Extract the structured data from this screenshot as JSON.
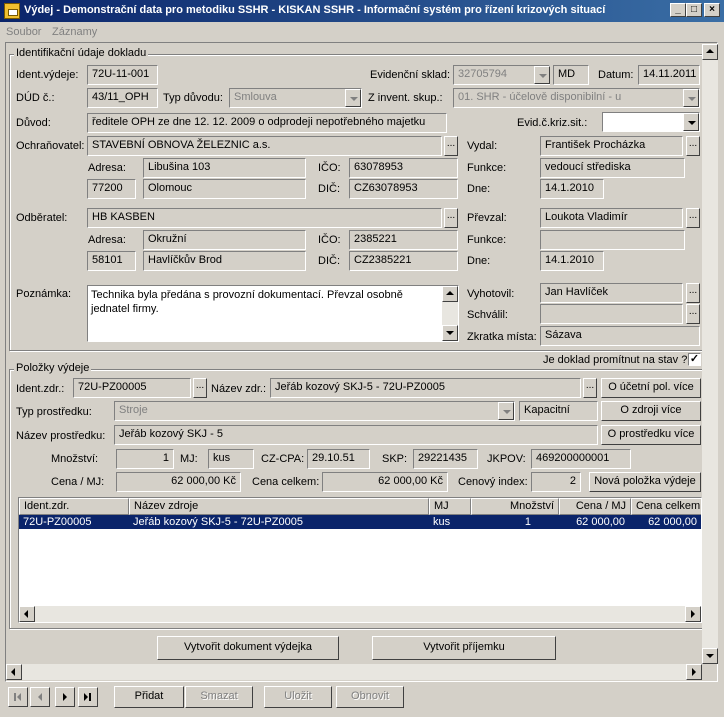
{
  "window": {
    "title": "Výdej - Demonstrační data pro metodiku SSHR - KISKAN SSHR - Informační systém pro řízení krizových situací",
    "minimize": "_",
    "maximize": "□",
    "close": "×"
  },
  "menu": {
    "items": [
      "Soubor",
      "Záznamy"
    ]
  },
  "ident": {
    "group_label": "Identifikační údaje dokladu",
    "ident_vydeje_label": "Ident.výdeje:",
    "ident_vydeje": "72U-11-001",
    "evid_sklad_label": "Evidenční sklad:",
    "evid_sklad": "32705794",
    "mj": "MD",
    "datum_label": "Datum:",
    "datum": "14.11.2011",
    "dud_label": "DÚD č.:",
    "dud": "43/11_OPH",
    "typ_duvodu_label": "Typ důvodu:",
    "typ_duvodu": "Smlouva",
    "z_invent_label": "Z invent. skup.:",
    "z_invent": "01. SHR - účelově disponibilní - u",
    "duvod_label": "Důvod:",
    "duvod": "ředitele OPH ze dne 12. 12. 2009 o odprodeji nepotřebného majetku",
    "evid_kriz_label": "Evid.č.kriz.sit.:",
    "evid_kriz": "",
    "ochranovatel_label": "Ochraňovatel:",
    "ochranovatel": "STAVEBNÍ OBNOVA ŽELEZNIC a.s.",
    "adresa_label": "Adresa:",
    "o_ulice": "Libušina 103",
    "ico_label": "IČO:",
    "o_ico": "63078953",
    "o_psc": "77200",
    "o_mesto": "Olomouc",
    "dic_label": "DIČ:",
    "o_dic": "CZ63078953",
    "vydal_label": "Vydal:",
    "vydal": "František Procházka",
    "funkce_label": "Funkce:",
    "vydal_funkce": "vedoucí střediska",
    "dne_label": "Dne:",
    "vydal_dne": "14.1.2010",
    "odberatel_label": "Odběratel:",
    "odberatel": "HB KASBEN",
    "d_ulice": "Okružní",
    "d_ico": "2385221",
    "d_psc": "58101",
    "d_mesto": "Havlíčkův Brod",
    "d_dic": "CZ2385221",
    "prevzal_label": "Převzal:",
    "prevzal": "Loukota Vladimír",
    "prevzal_funkce": "",
    "prevzal_dne": "14.1.2010",
    "poznamka_label": "Poznámka:",
    "poznamka": "Technika byla předána s provozní dokumentací. Převzal osobně jednatel firmy.",
    "vyhotovil_label": "Vyhotovil:",
    "vyhotovil": "Jan Havlíček",
    "schvalil_label": "Schválil:",
    "schvalil": "",
    "zkratka_label": "Zkratka místa:",
    "zkratka": "Sázava",
    "promitnut_label": "Je doklad promítnut na stav ?",
    "promitnut_mark": "✓"
  },
  "items": {
    "group_label": "Položky výdeje",
    "ident_zdr_label": "Ident.zdr.:",
    "ident_zdr": "72U-PZ00005",
    "nazev_zdr_label": "Název zdr.:",
    "nazev_zdr": "Jeřáb kozový SKJ-5 - 72U-PZ0005",
    "btn_ucetni": "O účetní pol. více",
    "typ_label": "Typ prostředku:",
    "typ": "Stroje",
    "kapacitni": "Kapacitní",
    "btn_zdroji": "O zdroji více",
    "nazev_prost_label": "Název prostředku:",
    "nazev_prost": "Jeřáb kozový  SKJ - 5",
    "btn_prostredku": "O prostředku více",
    "mnozstvi_label": "Množství:",
    "mnozstvi": "1",
    "mj_label": "MJ:",
    "mj": "kus",
    "cpa_label": "CZ-CPA:",
    "cpa": "29.10.51",
    "skp_label": "SKP:",
    "skp": "29221435",
    "jkpov_label": "JKPOV:",
    "jkpov": "469200000001",
    "cena_mj_label": "Cena / MJ:",
    "cena_mj": "62 000,00 Kč",
    "cena_celkem_label": "Cena celkem:",
    "cena_celkem": "62 000,00 Kč",
    "cenovy_index_label": "Cenový index:",
    "cenovy_index": "2",
    "btn_nova": "Nová položka výdeje"
  },
  "grid": {
    "columns": [
      "Ident.zdr.",
      "Název zdroje",
      "MJ",
      "Množství",
      "Cena / MJ",
      "Cena celkem"
    ],
    "rows": [
      [
        "72U-PZ00005",
        "Jeřáb kozový SKJ-5 - 72U-PZ0005",
        "kus",
        "1",
        "62 000,00",
        "62 000,00"
      ]
    ]
  },
  "actions": {
    "vytvorit_vydejka": "Vytvořit dokument výdejka",
    "vytvorit_prijemka": "Vytvořit příjemku"
  },
  "toolbar": {
    "pridat": "Přidat",
    "smazat": "Smazat",
    "ulozit": "Uložit",
    "obnovit": "Obnovit"
  }
}
